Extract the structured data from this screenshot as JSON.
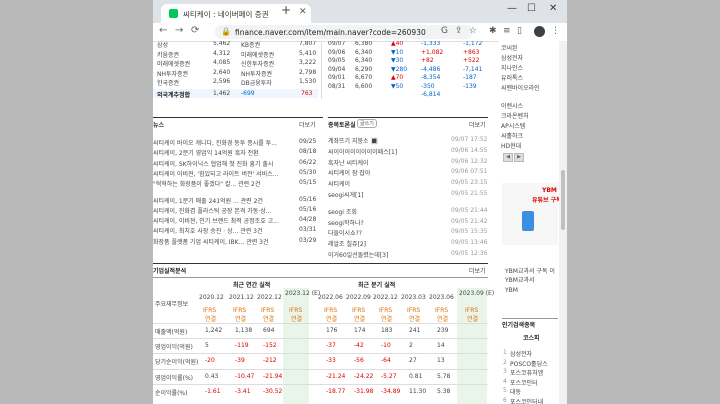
{
  "browser": {
    "tab_title": "씨티케이 : 네이버페이 증권",
    "url": "finance.naver.com/item/main.naver?code=260930"
  },
  "broker_table": {
    "rows": [
      {
        "c1": "삼성",
        "v1": "5,462",
        "c2": "KB증권",
        "v2": "7,807"
      },
      {
        "c1": "키움증권",
        "v1": "4,312",
        "c2": "미래에셋증권",
        "v2": "5,410"
      },
      {
        "c1": "미래에셋증권",
        "v1": "4,085",
        "c2": "신한투자증권",
        "v2": "3,222"
      },
      {
        "c1": "NH투자증권",
        "v1": "2,640",
        "c2": "NH투자증권",
        "v2": "2,798"
      },
      {
        "c1": "한국증권",
        "v1": "2,596",
        "c2": "DB금융투자",
        "v2": "1,530"
      }
    ],
    "foreign_label": "외국계추정합",
    "foreign_v1": "1,462",
    "foreign_v2": "-699",
    "foreign_v3": "763"
  },
  "daily_table": {
    "rows": [
      {
        "date": "09/07",
        "price": "6,380",
        "chg": "▲40",
        "vol": "-1,333",
        "vol2": "-1,172"
      },
      {
        "date": "09/06",
        "price": "6,340",
        "chg": "▼10",
        "vol": "+1,082",
        "vol2": "+863"
      },
      {
        "date": "09/05",
        "price": "6,340",
        "chg": "▼30",
        "vol": "+82",
        "vol2": "+522"
      },
      {
        "date": "09/04",
        "price": "6,290",
        "chg": "▼280",
        "vol": "-4,486",
        "vol2": "-7,141"
      },
      {
        "date": "09/01",
        "price": "6,670",
        "chg": "▲70",
        "vol": "-8,354",
        "vol2": "-187"
      },
      {
        "date": "08/31",
        "price": "6,600",
        "chg": "▼50",
        "vol": "-350",
        "vol2": "-139"
      },
      {
        "date": "",
        "price": "",
        "chg": "",
        "vol": "-6,814",
        "vol2": ""
      }
    ]
  },
  "news": {
    "title": "뉴스",
    "more": "더보기",
    "items": [
      {
        "t": "씨티케이 바이오 캐니다, 진화경 동투 증시를 투...",
        "d": "09/25"
      },
      {
        "t": "씨티케이, 2분기 영업익 14억원 흑자 전환",
        "d": "08/18"
      },
      {
        "t": "씨티케이, SK하이닉스 협업해 첫 진화 흥기 출시",
        "d": "06/22"
      },
      {
        "t": "씨티케이 이비젼, '힘있되고 라이트 버전' 서비스...",
        "d": "05/30"
      },
      {
        "t": "\"혁혁하는 화장품이 좋겠다\" 칼...     관련 2건",
        "d": "05/15"
      },
      {
        "t": "씨티케이, 1분기 매출 241억원 ... 관련 2건",
        "d": "05/16"
      },
      {
        "t": "씨티케이, 진화겸 플라스틱 공장 본격 가동·상...",
        "d": "05/16"
      },
      {
        "t": "씨티케이, 이비젼, 인기 브랜드 최적 공정조호 고...",
        "d": "04/28"
      },
      {
        "t": "씨티케이, 최치호 사장 승진 · 상... 관련 3건",
        "d": "03/31"
      },
      {
        "t": "화장품 플랫폼 기업 씨티케이, IBK... 관련 3건",
        "d": "03/29"
      }
    ]
  },
  "board": {
    "title": "종목토론실",
    "tag": "글쓰기",
    "more": "더보기",
    "items": [
      {
        "t": "계좌뜨기 지붕소 🔳",
        "d": "09/07 17:52"
      },
      {
        "t": "씨이이이이이이이이패스[1]",
        "d": "09/06 14:55"
      },
      {
        "t": "흑자난 씨티케이",
        "d": "09/06 12:32"
      },
      {
        "t": "씨티케이 잠 잡아",
        "d": "09/06 07:51"
      },
      {
        "t": "씨티케이",
        "d": "09/05 23:15"
      },
      {
        "t": "seogi씨게[1]",
        "d": "09/05 21:55"
      },
      {
        "t": "seogi 조회",
        "d": "09/05 21:44"
      },
      {
        "t": "seogi학하나?",
        "d": "09/05 21:42"
      },
      {
        "t": "다들이시쇼??",
        "d": "09/05 15:35"
      },
      {
        "t": "레알조 칠쥬[2]",
        "d": "09/05 13:46"
      },
      {
        "t": "이거60일선돌렸는데[3]",
        "d": "09/05 12:36"
      }
    ]
  },
  "fin": {
    "title": "기업실적분석",
    "more": "더보기",
    "annual_hdr": "최근 연간 실적",
    "quarter_hdr": "최근 분기 실적",
    "row_hdr": "주요재무정보",
    "years": [
      "2020.12",
      "2021.12",
      "2022.12",
      "2023.12 (E)"
    ],
    "quarters": [
      "2022.06",
      "2022.09",
      "2022.12",
      "2023.03",
      "2023.06",
      "2023.09 (E)"
    ],
    "ifrs": "IFRS 연결",
    "rows": [
      {
        "label": "매출액(억원)",
        "a": [
          "1,242",
          "1,138",
          "694",
          ""
        ],
        "q": [
          "176",
          "174",
          "183",
          "241",
          "239",
          ""
        ]
      },
      {
        "label": "영업이익(억원)",
        "a": [
          "5",
          "-119",
          "-152",
          ""
        ],
        "q": [
          "-37",
          "-42",
          "-10",
          "2",
          "14",
          ""
        ]
      },
      {
        "label": "당기순이익(억원)",
        "a": [
          "-20",
          "-39",
          "-212",
          ""
        ],
        "q": [
          "-33",
          "-56",
          "-64",
          "27",
          "13",
          ""
        ]
      },
      {
        "label": "영업이익률(%)",
        "a": [
          "0.43",
          "-10.47",
          "-21.94",
          ""
        ],
        "q": [
          "-21.24",
          "-24.22",
          "-5.27",
          "0.81",
          "5.78",
          ""
        ]
      },
      {
        "label": "순이익률(%)",
        "a": [
          "-1.61",
          "-3.41",
          "-30.52",
          ""
        ],
        "q": [
          "-18.77",
          "-31.98",
          "-34.89",
          "11.30",
          "5.38",
          ""
        ]
      }
    ]
  },
  "right_panel": {
    "items_top": [
      "코씨된",
      "삼성전자",
      "지나인스",
      "유러톡스",
      "씨맨바이오라인"
    ],
    "items_mid": [
      "이렌시스",
      "크라온벤처",
      "AP시스템",
      "씨홀하크",
      "HD현대"
    ],
    "ad_title": "YBM",
    "ad_sub": "유튜브 구독",
    "ad_text1": "YBM교과서 구독 이",
    "ad_text2": "YBM교과서",
    "ad_text3": "YBM",
    "rank_title": "인기검색종목",
    "rank_tab": "코스피",
    "rank_items": [
      "삼성전자",
      "POSCO홀딩스",
      "포스코퓨처엠",
      "포스코인터",
      "대동",
      "포스코인터내"
    ]
  }
}
